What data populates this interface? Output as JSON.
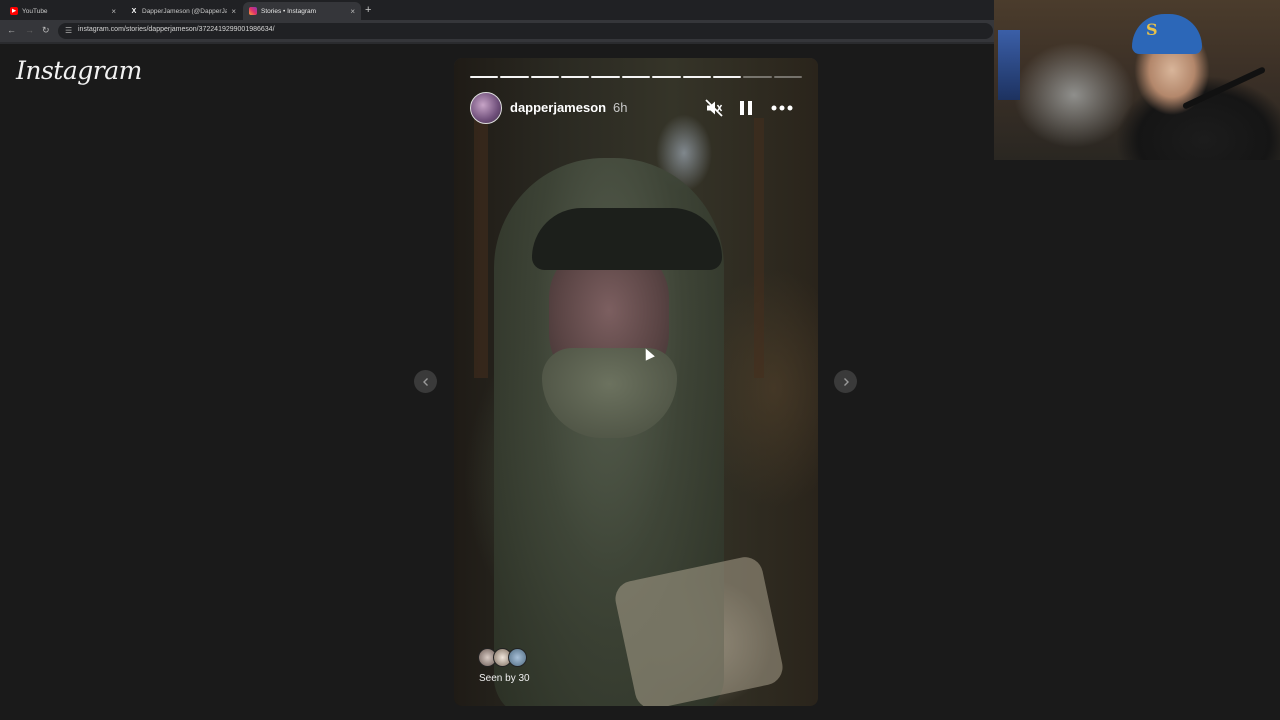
{
  "browser": {
    "tabs": [
      {
        "title": "YouTube",
        "favicon": "youtube-icon",
        "color": "#ff0000",
        "active": false
      },
      {
        "title": "DapperJameson (@DapperJam",
        "favicon": "x-icon",
        "color": "#ffffff",
        "active": false
      },
      {
        "title": "Stories • Instagram",
        "favicon": "instagram-icon",
        "color": "#e1306c",
        "active": true
      }
    ],
    "new_tab": "+",
    "close": "×",
    "url": "instagram.com/stories/dapperjameson/3722419299001986634/"
  },
  "instagram": {
    "logo": "Instagram"
  },
  "story": {
    "username": "dapperjameson",
    "time": "6h",
    "segments_total": 11,
    "segments_done": 9,
    "seen_by": "Seen by 30",
    "muted": true,
    "paused": false
  },
  "colors": {
    "background": "#1a1a1a",
    "tabbar": "#202124",
    "toolbar": "#35363a"
  }
}
